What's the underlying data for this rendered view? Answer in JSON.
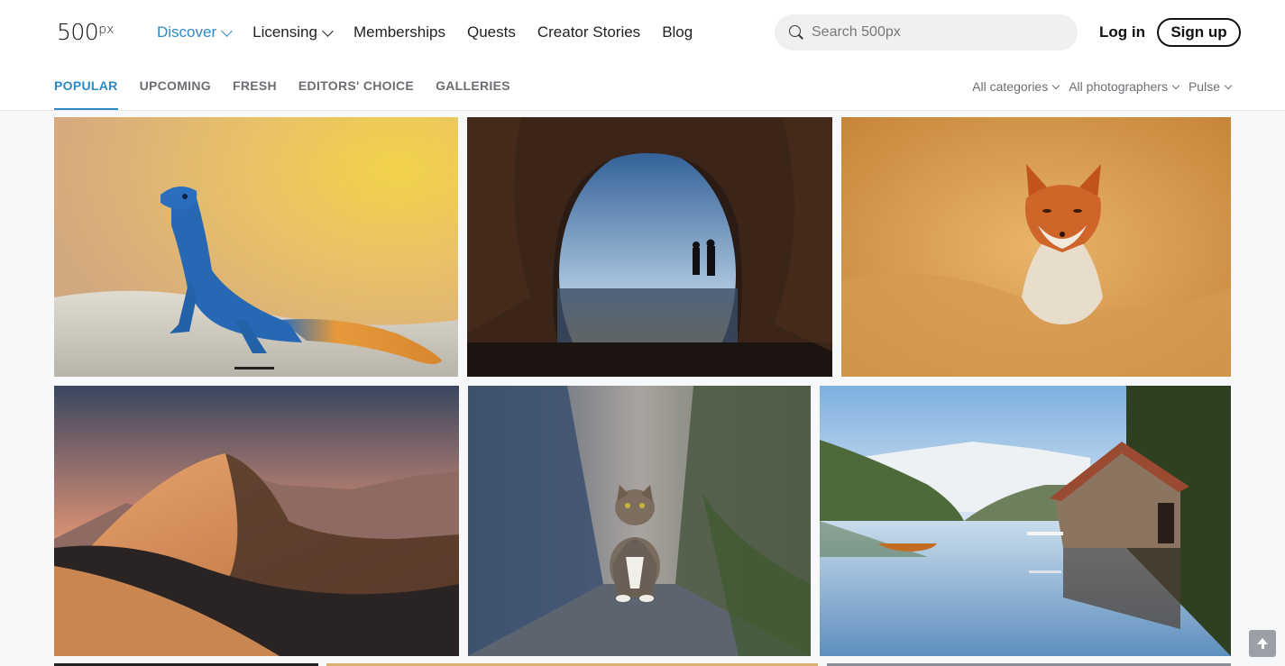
{
  "header": {
    "logo_main": "500",
    "logo_px": "px",
    "nav": [
      {
        "label": "Discover",
        "has_dropdown": true,
        "active": true
      },
      {
        "label": "Licensing",
        "has_dropdown": true,
        "active": false
      },
      {
        "label": "Memberships",
        "has_dropdown": false,
        "active": false
      },
      {
        "label": "Quests",
        "has_dropdown": false,
        "active": false
      },
      {
        "label": "Creator Stories",
        "has_dropdown": false,
        "active": false
      },
      {
        "label": "Blog",
        "has_dropdown": false,
        "active": false
      }
    ],
    "search": {
      "placeholder": "Search 500px",
      "value": ""
    },
    "login_label": "Log in",
    "signup_label": "Sign up"
  },
  "subnav": {
    "tabs": [
      {
        "label": "POPULAR",
        "active": true
      },
      {
        "label": "UPCOMING",
        "active": false
      },
      {
        "label": "FRESH",
        "active": false
      },
      {
        "label": "EDITORS' CHOICE",
        "active": false
      },
      {
        "label": "GALLERIES",
        "active": false
      }
    ],
    "filters": [
      {
        "label": "All categories"
      },
      {
        "label": "All photographers"
      },
      {
        "label": "Pulse"
      }
    ]
  },
  "photos": [
    {
      "subject": "blue lizard on rock"
    },
    {
      "subject": "couple silhouetted in cave at sunset"
    },
    {
      "subject": "red fox in golden grass"
    },
    {
      "subject": "sand dunes at sunset"
    },
    {
      "subject": "tabby cat in alley"
    },
    {
      "subject": "boathouse on fjord"
    }
  ],
  "colors": {
    "accent": "#2e8ac6",
    "text": "#222222",
    "muted": "#6b6f74",
    "search_bg": "#eef0f2",
    "page_bg": "#f7f8fa"
  },
  "icons": [
    "chevron-down-icon",
    "search-icon",
    "arrow-up-icon"
  ]
}
